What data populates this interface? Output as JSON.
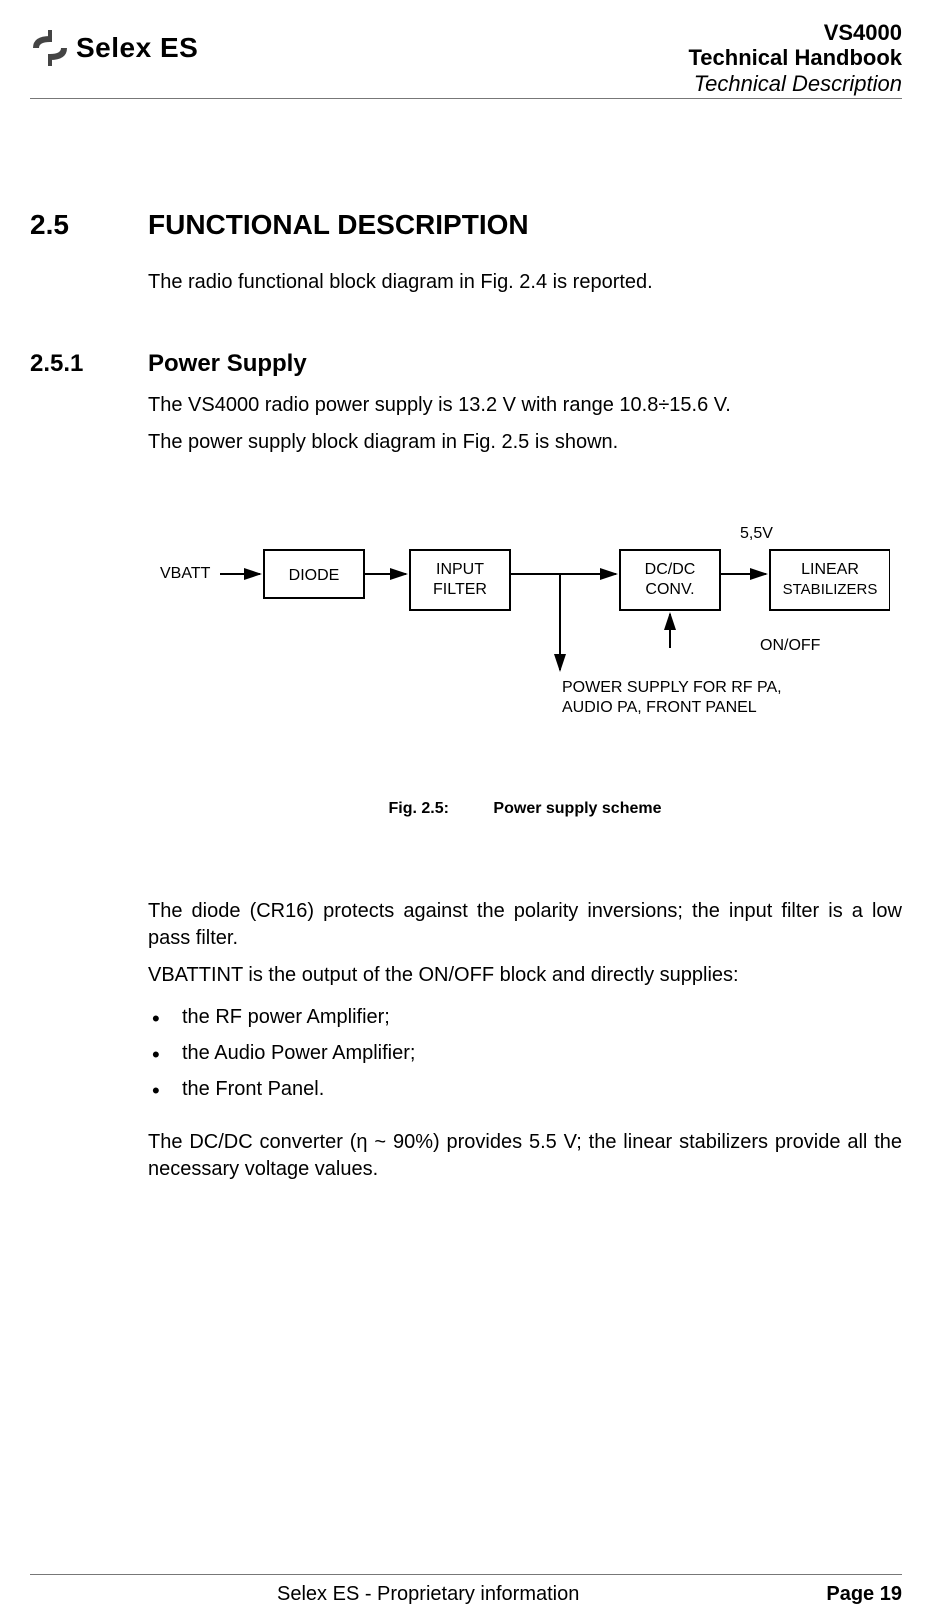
{
  "header": {
    "logo_text": "Selex ES",
    "line1": "VS4000",
    "line2": "Technical Handbook",
    "line3": "Technical Description"
  },
  "section": {
    "num": "2.5",
    "title": "FUNCTIONAL DESCRIPTION",
    "intro": "The radio functional block diagram in Fig. 2.4 is reported."
  },
  "subsection": {
    "num": "2.5.1",
    "title": "Power Supply",
    "p1": "The VS4000 radio power supply is 13.2 V with range 10.8÷15.6 V.",
    "p2": "The power supply block diagram in Fig. 2.5 is shown."
  },
  "diagram": {
    "vbatt": "VBATT",
    "diode": "DIODE",
    "input_filter_l1": "INPUT",
    "input_filter_l2": "FILTER",
    "dcdc_l1": "DC/DC",
    "dcdc_l2": "CONV.",
    "stab_l1": "LINEAR",
    "stab_l2": "STABILIZERS",
    "v55": "5,5V",
    "onoff": "ON/OFF",
    "ps_l1": "POWER SUPPLY FOR RF PA,",
    "ps_l2": "AUDIO PA, FRONT PANEL"
  },
  "figure": {
    "label": "Fig. 2.5:",
    "caption": "Power supply scheme"
  },
  "body2": {
    "p1": "The diode (CR16) protects against the polarity inversions; the input filter is a low pass filter.",
    "p2": "VBATTINT is the output of the ON/OFF block and directly supplies:",
    "bullets": [
      "the RF power Amplifier;",
      "the Audio Power Amplifier;",
      "the Front Panel."
    ],
    "p3": "The DC/DC converter (η ~ 90%) provides 5.5 V; the linear stabilizers provide all the necessary voltage values."
  },
  "footer": {
    "center": "Selex ES - Proprietary information",
    "page": "Page 19"
  }
}
